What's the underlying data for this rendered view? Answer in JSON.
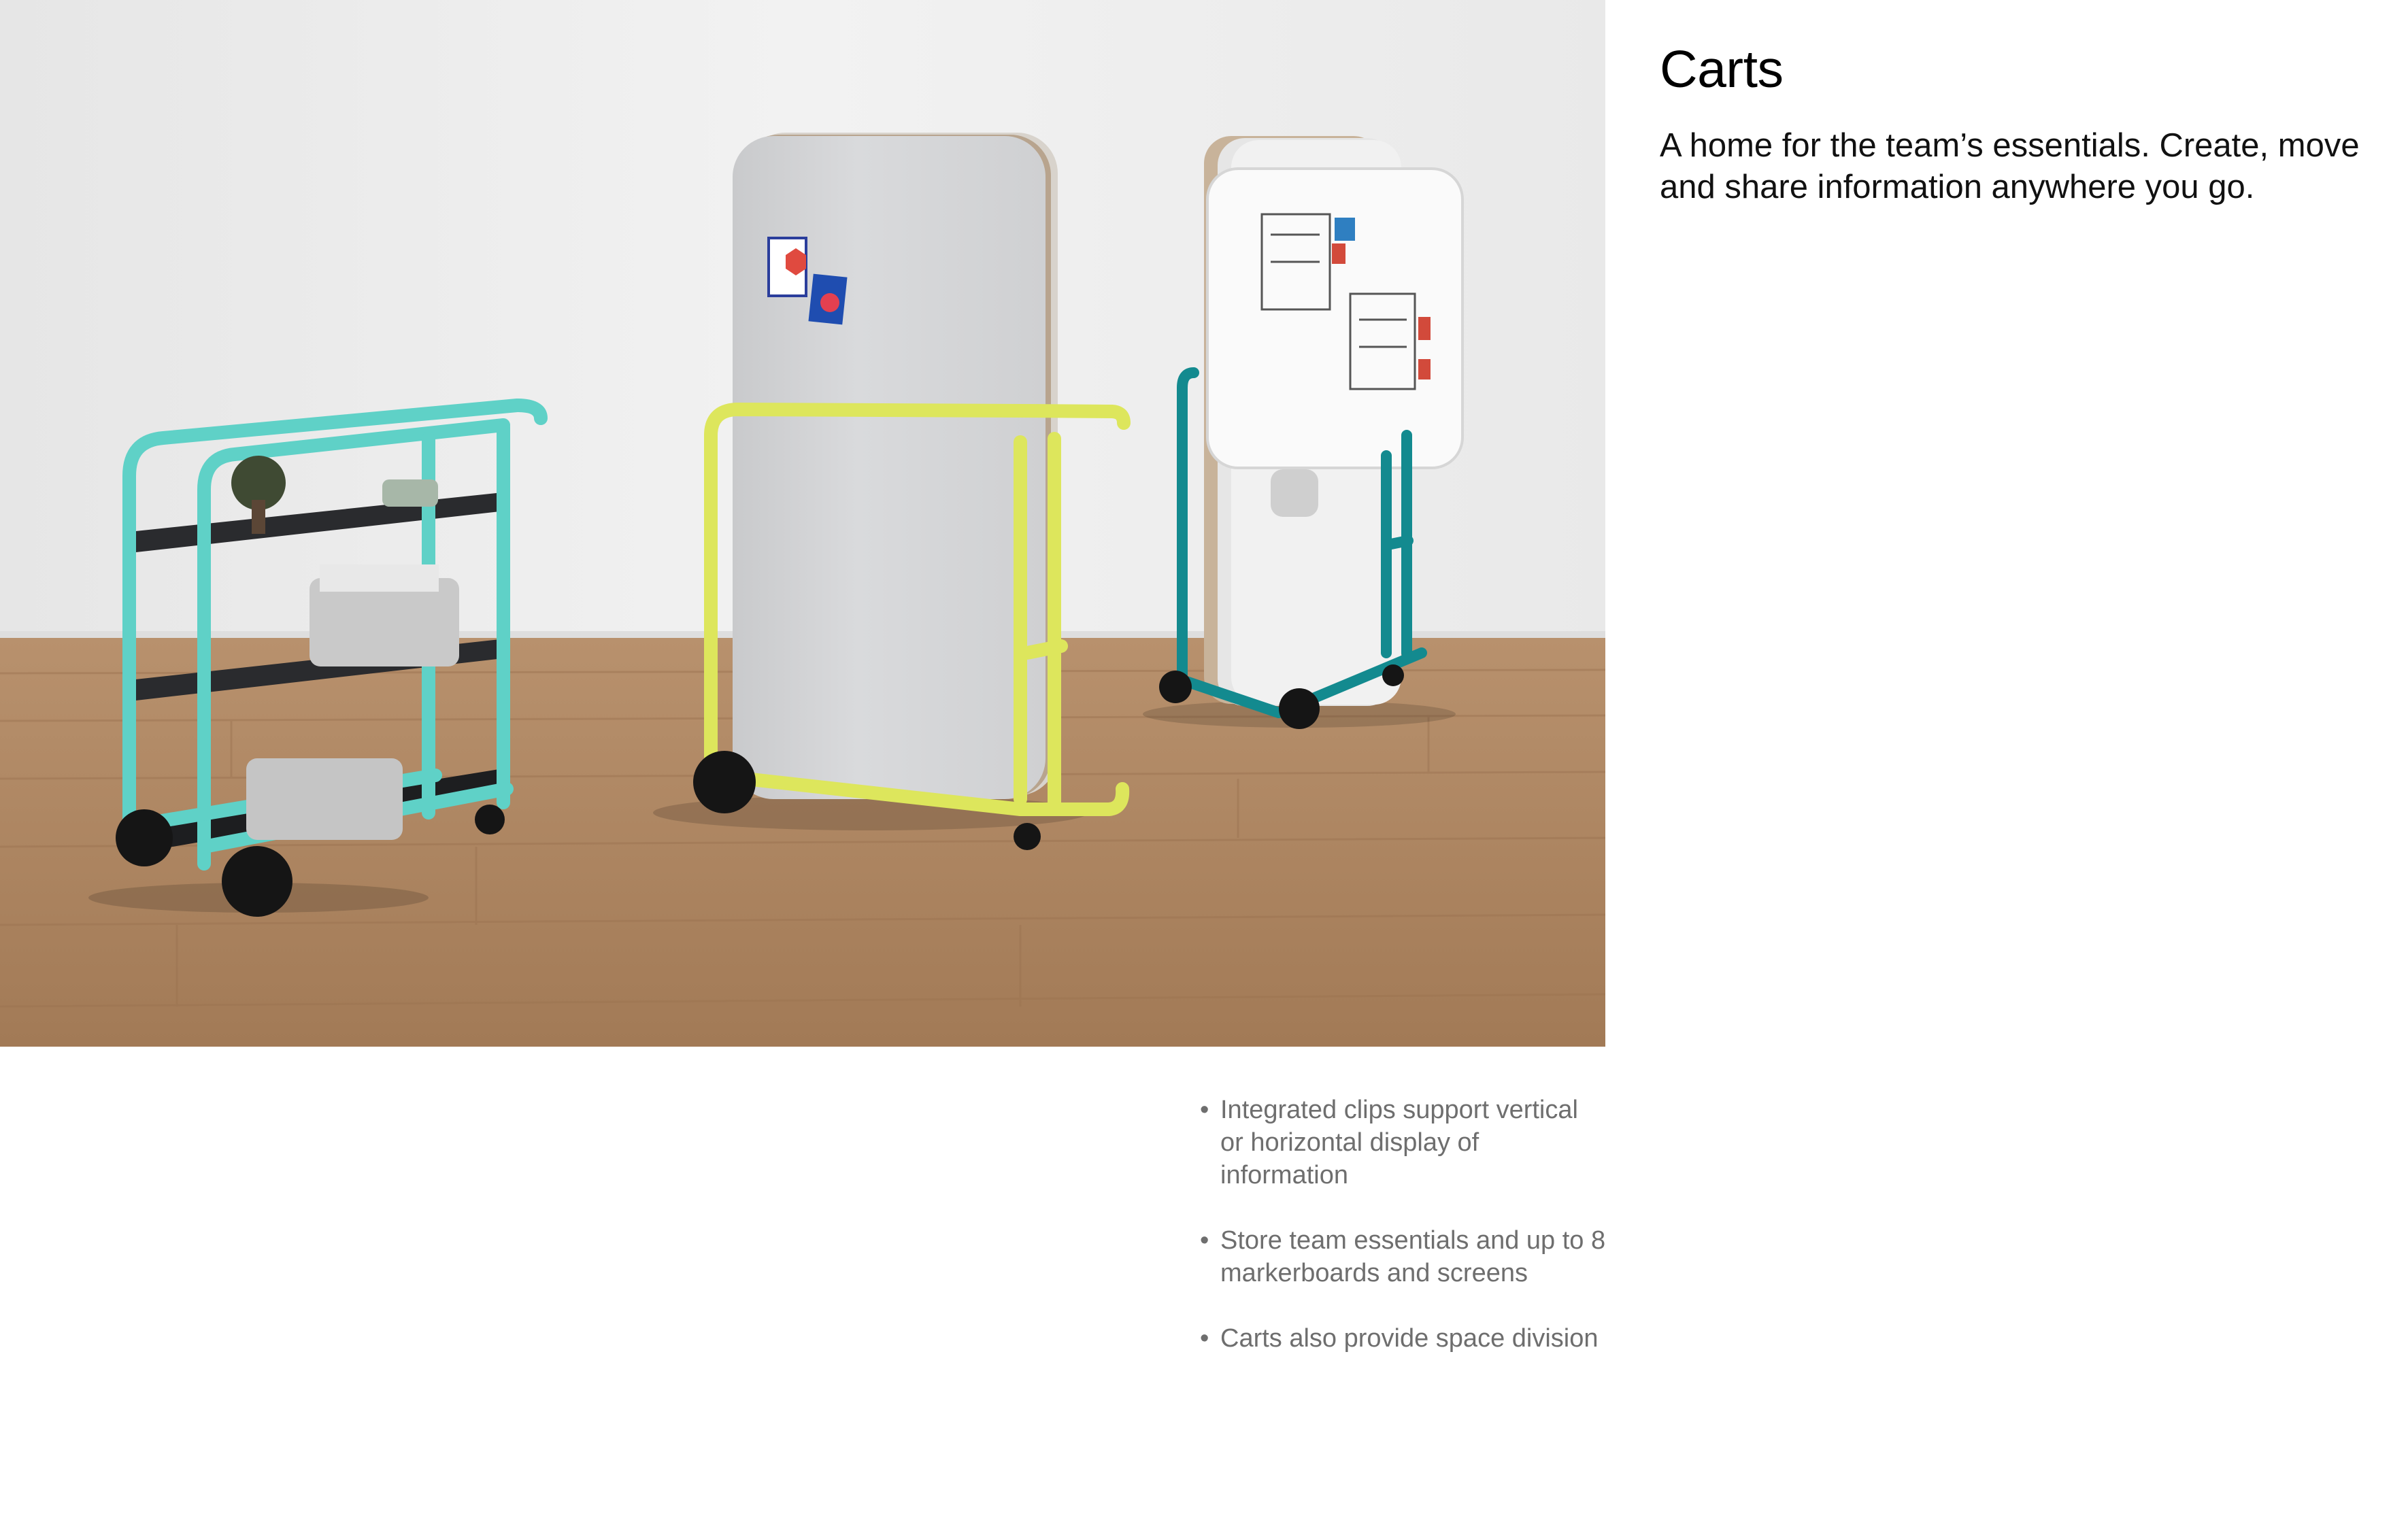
{
  "heading": {
    "title": "Carts",
    "subtitle": "A home for the team’s essentials. Create, move and share information anywhere you go."
  },
  "photo": {
    "subject": "Three mobile carts (aqua shelving cart, yellow screen cart, teal markerboard cart) on a wood floor"
  },
  "features": [
    {
      "bullet": "•",
      "text": "Integrated clips support vertical or horizontal display of information"
    },
    {
      "bullet": "•",
      "text": "Store team essentials and up to 8 markerboards and screens"
    },
    {
      "bullet": "•",
      "text": "Carts also provide space division"
    }
  ],
  "colors": {
    "aqua_cart": "#5fd1c7",
    "yellow_cart": "#dde65c",
    "teal_cart": "#138a8f",
    "wall": "#e9e9e9",
    "floor": "#a98260",
    "text_dark": "#000000",
    "text_muted": "#6e6e6e"
  }
}
